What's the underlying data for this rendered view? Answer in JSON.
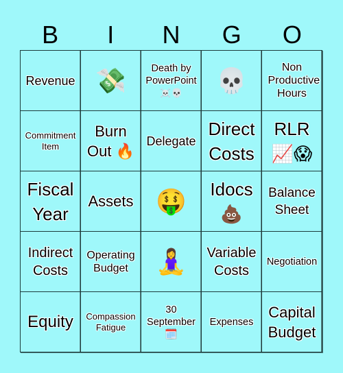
{
  "header": {
    "letters": [
      "B",
      "I",
      "N",
      "G",
      "O"
    ]
  },
  "colors": {
    "background": "#9ff8fa",
    "grid_line": "#1d3b3b",
    "text": "#000000"
  },
  "cells": [
    {
      "text": "Revenue",
      "emoji": ""
    },
    {
      "text": "",
      "emoji": "💸",
      "icon": "money-with-wings-icon"
    },
    {
      "text": "Death by PowerPoint",
      "emoji": "☠️💀",
      "icon": "skull-crossbones-icon"
    },
    {
      "text": "",
      "emoji": "💀",
      "icon": "skull-icon"
    },
    {
      "text": "Non Productive Hours",
      "emoji": ""
    },
    {
      "text": "Commitment Item",
      "emoji": ""
    },
    {
      "text": "Burn Out",
      "emoji": "🔥",
      "icon": "fire-icon"
    },
    {
      "text": "Delegate",
      "emoji": ""
    },
    {
      "text": "Direct Costs",
      "emoji": ""
    },
    {
      "text": "RLR",
      "emoji": "📈😱",
      "icon": "chart-scream-icon"
    },
    {
      "text": "Fiscal Year",
      "emoji": ""
    },
    {
      "text": "Assets",
      "emoji": ""
    },
    {
      "text": "",
      "emoji": "🤑",
      "icon": "money-mouth-face-icon"
    },
    {
      "text": "Idocs",
      "emoji": "💩",
      "icon": "pile-of-poo-icon"
    },
    {
      "text": "Balance Sheet",
      "emoji": ""
    },
    {
      "text": "Indirect Costs",
      "emoji": ""
    },
    {
      "text": "Operating Budget",
      "emoji": ""
    },
    {
      "text": "",
      "emoji": "🧘‍♀️",
      "icon": "woman-lotus-position-icon"
    },
    {
      "text": "Variable Costs",
      "emoji": ""
    },
    {
      "text": "Negotiation",
      "emoji": ""
    },
    {
      "text": "Equity",
      "emoji": ""
    },
    {
      "text": "Compassion Fatigue",
      "emoji": ""
    },
    {
      "text": "30 September",
      "emoji": "🗓️",
      "icon": "calendar-icon"
    },
    {
      "text": "Expenses",
      "emoji": ""
    },
    {
      "text": "Capital Budget",
      "emoji": ""
    }
  ]
}
